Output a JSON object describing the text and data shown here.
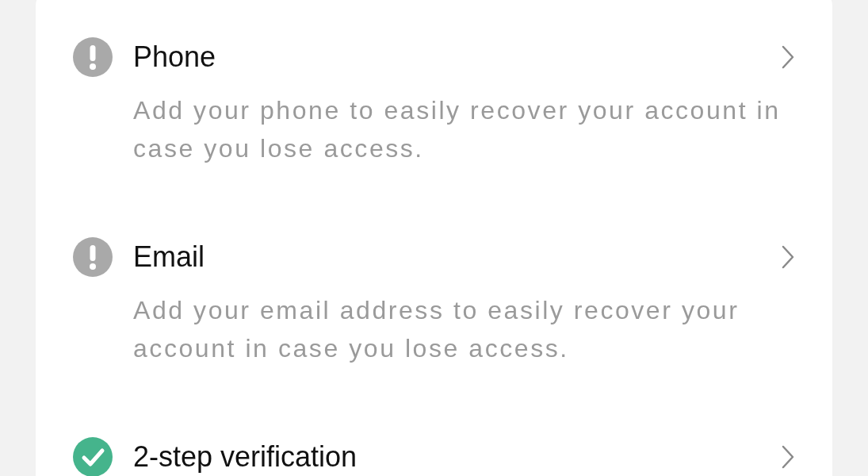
{
  "items": [
    {
      "title": "Phone",
      "description": "Add your phone to easily recover your account in case you lose access.",
      "verified": false
    },
    {
      "title": "Email",
      "description": "Add your email address to easily recover your account in case you lose access.",
      "verified": false
    },
    {
      "title": "2-step verification",
      "verified": true
    }
  ]
}
